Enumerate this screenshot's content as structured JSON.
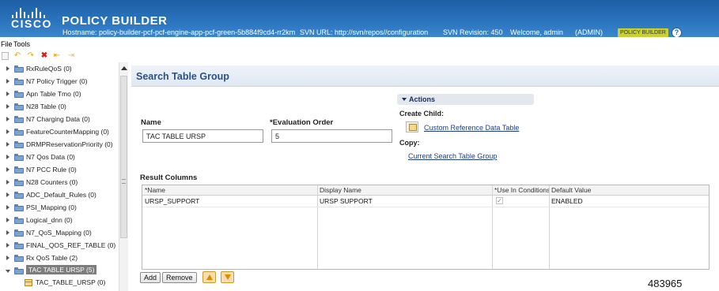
{
  "header": {
    "logo": "CISCO",
    "title": "POLICY BUILDER",
    "hostname": "Hostname: policy-builder-pcf-pcf-engine-app-pcf-green-5b884f9cd4-rr2km",
    "svn_url": "SVN URL: http://svn/repos//configuration",
    "svn_revision": "SVN Revision: 450",
    "welcome": "Welcome, admin",
    "role": "(ADMIN)",
    "badge": "POLICY BUILDER",
    "help_icon": "help-icon",
    "colors": {
      "header_blue": "#2a73bd",
      "badge": "#c8d12f"
    }
  },
  "menu": {
    "file": "File",
    "tools": "Tools"
  },
  "toolbar": {
    "icons": [
      "new-icon",
      "back-icon",
      "forward-icon",
      "delete-icon",
      "import-icon",
      "export-icon"
    ]
  },
  "tree": {
    "items": [
      {
        "label": "RxRuleQoS (0)"
      },
      {
        "label": "N7 Policy Trigger (0)"
      },
      {
        "label": "Apn Table Tmo (0)"
      },
      {
        "label": "N28 Table (0)"
      },
      {
        "label": "N7 Charging Data (0)"
      },
      {
        "label": "FeatureCounterMapping (0)"
      },
      {
        "label": "DRMPReservationPriority (0)"
      },
      {
        "label": "N7 Qos Data (0)"
      },
      {
        "label": "N7 PCC Rule (0)"
      },
      {
        "label": "N28 Counters (0)"
      },
      {
        "label": "ADC_Default_Rules (0)"
      },
      {
        "label": "PSI_Mapping (0)"
      },
      {
        "label": "Logical_dnn (0)"
      },
      {
        "label": "N7_QoS_Mapping (0)"
      },
      {
        "label": "FINAL_QOS_REF_TABLE (0)"
      },
      {
        "label": "Rx QoS Table (2)"
      },
      {
        "label": "TAC TABLE URSP (5)"
      },
      {
        "label": "TAC_TABLE_URSP (0)"
      }
    ]
  },
  "panel": {
    "title": "Search Table Group",
    "name_label": "Name",
    "name_value": "TAC TABLE URSP",
    "eval_label": "*Evaluation Order",
    "eval_value": "5",
    "actions_label": "Actions",
    "create_child_label": "Create Child:",
    "create_child_link": "Custom Reference Data Table",
    "copy_label": "Copy:",
    "copy_link": "Current Search Table Group",
    "result_columns_label": "Result Columns",
    "table": {
      "headers": [
        "*Name",
        "Display Name",
        "*Use In Conditions",
        "Default Value"
      ],
      "rows": [
        {
          "name": "URSP_SUPPORT",
          "display": "URSP SUPPORT",
          "use_in_conditions": true,
          "default": "ENABLED"
        }
      ]
    },
    "buttons": {
      "add": "Add",
      "remove": "Remove"
    }
  },
  "footer_code": "483965"
}
